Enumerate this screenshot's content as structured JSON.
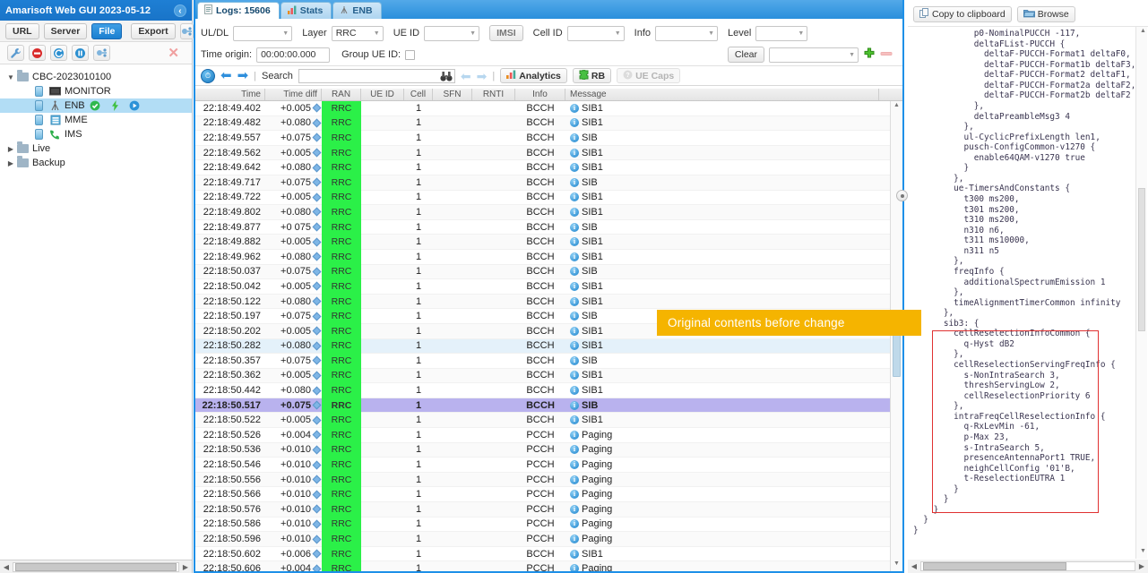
{
  "left": {
    "title": "Amarisoft Web GUI 2023-05-12",
    "collapse_icon": "chevron-left-icon",
    "buttons": {
      "url": "URL",
      "server": "Server",
      "file": "File",
      "export": "Export"
    },
    "toolbar_icons": [
      "wrench-icon",
      "stop-icon",
      "refresh-icon",
      "pause-icon",
      "plug-icon",
      "close-icon"
    ],
    "tree": [
      {
        "label": "CBC-2023010100",
        "type": "folder",
        "depth": 0,
        "expanded": true,
        "selected": false,
        "icon": "folder-icon"
      },
      {
        "label": "MONITOR",
        "type": "leaf",
        "depth": 1,
        "selected": false,
        "icon": "monitor-icon"
      },
      {
        "label": "ENB",
        "type": "leaf",
        "depth": 1,
        "selected": true,
        "icon": "antenna-icon",
        "badges": [
          "check-ok-icon",
          "lightning-icon",
          "play-icon"
        ]
      },
      {
        "label": "MME",
        "type": "leaf",
        "depth": 1,
        "selected": false,
        "icon": "server-icon"
      },
      {
        "label": "IMS",
        "type": "leaf",
        "depth": 1,
        "selected": false,
        "icon": "phone-icon"
      },
      {
        "label": "Live",
        "type": "folder",
        "depth": 0,
        "expanded": false,
        "selected": false,
        "icon": "folder-icon"
      },
      {
        "label": "Backup",
        "type": "folder",
        "depth": 0,
        "expanded": false,
        "selected": false,
        "icon": "folder-icon"
      }
    ]
  },
  "tabs": [
    {
      "label": "Logs: 15606",
      "icon": "document-icon",
      "active": true
    },
    {
      "label": "Stats",
      "icon": "bar-chart-icon",
      "active": false
    },
    {
      "label": "ENB",
      "icon": "antenna-icon",
      "active": false
    }
  ],
  "filters": {
    "uldl_label": "UL/DL",
    "uldl_value": "",
    "layer_label": "Layer",
    "layer_value": "RRC",
    "ueid_label": "UE ID",
    "ueid_value": "",
    "imsi_label": "IMSI",
    "cellid_label": "Cell ID",
    "cellid_value": "",
    "info_label": "Info",
    "info_value": "",
    "level_label": "Level",
    "level_value": "",
    "time_origin_label": "Time origin:",
    "time_origin_value": "00:00:00.000",
    "group_ueid_label": "Group UE ID:",
    "group_ueid_checked": false,
    "clear_label": "Clear",
    "preset_value": "",
    "add_icon": "plus-icon",
    "remove_icon": "minus-icon"
  },
  "searchbar": {
    "clock_icon": "clock-icon",
    "back_icon": "arrow-left-icon",
    "forward_icon": "arrow-right-icon",
    "search_label": "Search",
    "search_value": "",
    "search_placeholder": "",
    "binoculars_icon": "binoculars-icon",
    "prev_icon": "arrow-left-dim-icon",
    "next_icon": "arrow-right-dim-icon",
    "analytics_label": "Analytics",
    "analytics_icon": "bar-chart-icon",
    "rb_label": "RB",
    "rb_icon": "puzzle-icon",
    "uecaps_label": "UE Caps",
    "uecaps_icon": "help-icon",
    "uecaps_disabled": true
  },
  "table": {
    "columns": [
      "Time",
      "Time diff",
      "RAN",
      "UE ID",
      "Cell",
      "SFN",
      "RNTI",
      "Info",
      "Message"
    ],
    "rows": [
      {
        "time": "22:18:49.402",
        "diff": "+0.005",
        "ran": "RRC",
        "ueid": "",
        "cell": "1",
        "sfn": "",
        "rnti": "",
        "info": "BCCH",
        "msg": "SIB1",
        "state": "even"
      },
      {
        "time": "22:18:49.482",
        "diff": "+0.080",
        "ran": "RRC",
        "ueid": "",
        "cell": "1",
        "sfn": "",
        "rnti": "",
        "info": "BCCH",
        "msg": "SIB1",
        "state": "odd"
      },
      {
        "time": "22:18:49.557",
        "diff": "+0.075",
        "ran": "RRC",
        "ueid": "",
        "cell": "1",
        "sfn": "",
        "rnti": "",
        "info": "BCCH",
        "msg": "SIB",
        "state": "even"
      },
      {
        "time": "22:18:49.562",
        "diff": "+0.005",
        "ran": "RRC",
        "ueid": "",
        "cell": "1",
        "sfn": "",
        "rnti": "",
        "info": "BCCH",
        "msg": "SIB1",
        "state": "odd"
      },
      {
        "time": "22:18:49.642",
        "diff": "+0.080",
        "ran": "RRC",
        "ueid": "",
        "cell": "1",
        "sfn": "",
        "rnti": "",
        "info": "BCCH",
        "msg": "SIB1",
        "state": "even"
      },
      {
        "time": "22:18:49.717",
        "diff": "+0.075",
        "ran": "RRC",
        "ueid": "",
        "cell": "1",
        "sfn": "",
        "rnti": "",
        "info": "BCCH",
        "msg": "SIB",
        "state": "odd"
      },
      {
        "time": "22:18:49.722",
        "diff": "+0.005",
        "ran": "RRC",
        "ueid": "",
        "cell": "1",
        "sfn": "",
        "rnti": "",
        "info": "BCCH",
        "msg": "SIB1",
        "state": "even"
      },
      {
        "time": "22:18:49.802",
        "diff": "+0.080",
        "ran": "RRC",
        "ueid": "",
        "cell": "1",
        "sfn": "",
        "rnti": "",
        "info": "BCCH",
        "msg": "SIB1",
        "state": "odd"
      },
      {
        "time": "22:18:49.877",
        "diff": "+0 075",
        "ran": "RRC",
        "ueid": "",
        "cell": "1",
        "sfn": "",
        "rnti": "",
        "info": "BCCH",
        "msg": "SIB",
        "state": "even"
      },
      {
        "time": "22:18:49.882",
        "diff": "+0.005",
        "ran": "RRC",
        "ueid": "",
        "cell": "1",
        "sfn": "",
        "rnti": "",
        "info": "BCCH",
        "msg": "SIB1",
        "state": "odd"
      },
      {
        "time": "22:18:49.962",
        "diff": "+0.080",
        "ran": "RRC",
        "ueid": "",
        "cell": "1",
        "sfn": "",
        "rnti": "",
        "info": "BCCH",
        "msg": "SIB1",
        "state": "even"
      },
      {
        "time": "22:18:50.037",
        "diff": "+0.075",
        "ran": "RRC",
        "ueid": "",
        "cell": "1",
        "sfn": "",
        "rnti": "",
        "info": "BCCH",
        "msg": "SIB",
        "state": "odd"
      },
      {
        "time": "22:18:50.042",
        "diff": "+0.005",
        "ran": "RRC",
        "ueid": "",
        "cell": "1",
        "sfn": "",
        "rnti": "",
        "info": "BCCH",
        "msg": "SIB1",
        "state": "even"
      },
      {
        "time": "22:18:50.122",
        "diff": "+0.080",
        "ran": "RRC",
        "ueid": "",
        "cell": "1",
        "sfn": "",
        "rnti": "",
        "info": "BCCH",
        "msg": "SIB1",
        "state": "odd"
      },
      {
        "time": "22:18:50.197",
        "diff": "+0.075",
        "ran": "RRC",
        "ueid": "",
        "cell": "1",
        "sfn": "",
        "rnti": "",
        "info": "BCCH",
        "msg": "SIB",
        "state": "even"
      },
      {
        "time": "22:18:50.202",
        "diff": "+0.005",
        "ran": "RRC",
        "ueid": "",
        "cell": "1",
        "sfn": "",
        "rnti": "",
        "info": "BCCH",
        "msg": "SIB1",
        "state": "odd"
      },
      {
        "time": "22:18:50.282",
        "diff": "+0.080",
        "ran": "RRC",
        "ueid": "",
        "cell": "1",
        "sfn": "",
        "rnti": "",
        "info": "BCCH",
        "msg": "SIB1",
        "state": "hover"
      },
      {
        "time": "22:18:50.357",
        "diff": "+0.075",
        "ran": "RRC",
        "ueid": "",
        "cell": "1",
        "sfn": "",
        "rnti": "",
        "info": "BCCH",
        "msg": "SIB",
        "state": "even"
      },
      {
        "time": "22:18:50.362",
        "diff": "+0.005",
        "ran": "RRC",
        "ueid": "",
        "cell": "1",
        "sfn": "",
        "rnti": "",
        "info": "BCCH",
        "msg": "SIB1",
        "state": "odd"
      },
      {
        "time": "22:18:50.442",
        "diff": "+0.080",
        "ran": "RRC",
        "ueid": "",
        "cell": "1",
        "sfn": "",
        "rnti": "",
        "info": "BCCH",
        "msg": "SIB1",
        "state": "even"
      },
      {
        "time": "22:18:50.517",
        "diff": "+0.075",
        "ran": "RRC",
        "ueid": "",
        "cell": "1",
        "sfn": "",
        "rnti": "",
        "info": "BCCH",
        "msg": "SIB",
        "state": "sel"
      },
      {
        "time": "22:18:50.522",
        "diff": "+0.005",
        "ran": "RRC",
        "ueid": "",
        "cell": "1",
        "sfn": "",
        "rnti": "",
        "info": "BCCH",
        "msg": "SIB1",
        "state": "odd"
      },
      {
        "time": "22:18:50.526",
        "diff": "+0.004",
        "ran": "RRC",
        "ueid": "",
        "cell": "1",
        "sfn": "",
        "rnti": "",
        "info": "PCCH",
        "msg": "Paging",
        "state": "even"
      },
      {
        "time": "22:18:50.536",
        "diff": "+0.010",
        "ran": "RRC",
        "ueid": "",
        "cell": "1",
        "sfn": "",
        "rnti": "",
        "info": "PCCH",
        "msg": "Paging",
        "state": "odd"
      },
      {
        "time": "22:18:50.546",
        "diff": "+0.010",
        "ran": "RRC",
        "ueid": "",
        "cell": "1",
        "sfn": "",
        "rnti": "",
        "info": "PCCH",
        "msg": "Paging",
        "state": "even"
      },
      {
        "time": "22:18:50.556",
        "diff": "+0.010",
        "ran": "RRC",
        "ueid": "",
        "cell": "1",
        "sfn": "",
        "rnti": "",
        "info": "PCCH",
        "msg": "Paging",
        "state": "odd"
      },
      {
        "time": "22:18:50.566",
        "diff": "+0.010",
        "ran": "RRC",
        "ueid": "",
        "cell": "1",
        "sfn": "",
        "rnti": "",
        "info": "PCCH",
        "msg": "Paging",
        "state": "even"
      },
      {
        "time": "22:18:50.576",
        "diff": "+0.010",
        "ran": "RRC",
        "ueid": "",
        "cell": "1",
        "sfn": "",
        "rnti": "",
        "info": "PCCH",
        "msg": "Paging",
        "state": "odd"
      },
      {
        "time": "22:18:50.586",
        "diff": "+0.010",
        "ran": "RRC",
        "ueid": "",
        "cell": "1",
        "sfn": "",
        "rnti": "",
        "info": "PCCH",
        "msg": "Paging",
        "state": "even"
      },
      {
        "time": "22:18:50.596",
        "diff": "+0.010",
        "ran": "RRC",
        "ueid": "",
        "cell": "1",
        "sfn": "",
        "rnti": "",
        "info": "PCCH",
        "msg": "Paging",
        "state": "odd"
      },
      {
        "time": "22:18:50.602",
        "diff": "+0.006",
        "ran": "RRC",
        "ueid": "",
        "cell": "1",
        "sfn": "",
        "rnti": "",
        "info": "BCCH",
        "msg": "SIB1",
        "state": "even"
      },
      {
        "time": "22:18:50.606",
        "diff": "+0.004",
        "ran": "RRC",
        "ueid": "",
        "cell": "1",
        "sfn": "",
        "rnti": "",
        "info": "PCCH",
        "msg": "Paging",
        "state": "odd"
      }
    ]
  },
  "right": {
    "copy_label": "Copy to clipboard",
    "copy_icon": "copy-icon",
    "browse_label": "Browse",
    "browse_icon": "folder-open-icon",
    "message_text": "            p0-NominalPUCCH -117,\n            deltaFList-PUCCH {\n              deltaF-PUCCH-Format1 deltaF0,\n              deltaF-PUCCH-Format1b deltaF3,\n              deltaF-PUCCH-Format2 deltaF1,\n              deltaF-PUCCH-Format2a deltaF2,\n              deltaF-PUCCH-Format2b deltaF2\n            },\n            deltaPreambleMsg3 4\n          },\n          ul-CyclicPrefixLength len1,\n          pusch-ConfigCommon-v1270 {\n            enable64QAM-v1270 true\n          }\n        },\n        ue-TimersAndConstants {\n          t300 ms200,\n          t301 ms200,\n          t310 ms200,\n          n310 n6,\n          t311 ms10000,\n          n311 n5\n        },\n        freqInfo {\n          additionalSpectrumEmission 1\n        },\n        timeAlignmentTimerCommon infinity\n      },\n      sib3: {\n        cellReselectionInfoCommon {\n          q-Hyst dB2\n        },\n        cellReselectionServingFreqInfo {\n          s-NonIntraSearch 3,\n          threshServingLow 2,\n          cellReselectionPriority 6\n        },\n        intraFreqCellReselectionInfo {\n          q-RxLevMin -61,\n          p-Max 23,\n          s-IntraSearch 5,\n          presenceAntennaPort1 TRUE,\n          neighCellConfig '01'B,\n          t-ReselectionEUTRA 1\n        }\n      }\n    }\n  }\n}"
  },
  "annotation": {
    "callout_text": "Original contents before change",
    "callout_color": "#f5b400",
    "highlight_box_color": "#e03131"
  }
}
